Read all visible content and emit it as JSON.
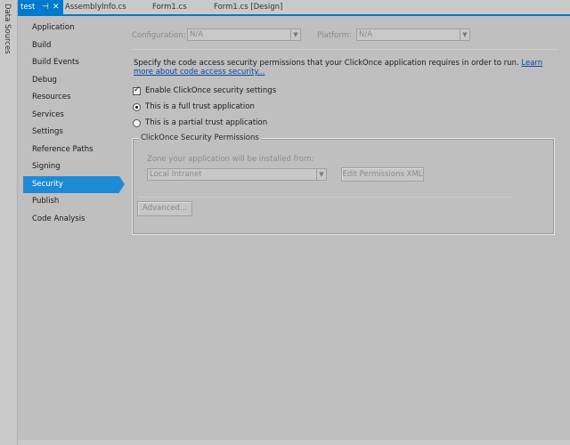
{
  "side_strip": {
    "label": "Data Sources"
  },
  "tabs": {
    "active": {
      "label": "test",
      "pin": "⊣",
      "close": "✕"
    },
    "items": [
      {
        "label": "AssemblyInfo.cs"
      },
      {
        "label": "Form1.cs"
      },
      {
        "label": "Form1.cs [Design]"
      }
    ]
  },
  "nav": {
    "items": [
      {
        "label": "Application"
      },
      {
        "label": "Build"
      },
      {
        "label": "Build Events"
      },
      {
        "label": "Debug"
      },
      {
        "label": "Resources"
      },
      {
        "label": "Services"
      },
      {
        "label": "Settings"
      },
      {
        "label": "Reference Paths"
      },
      {
        "label": "Signing"
      },
      {
        "label": "Security"
      },
      {
        "label": "Publish"
      },
      {
        "label": "Code Analysis"
      }
    ],
    "selected_index": 9
  },
  "config": {
    "configuration_label": "Configuration:",
    "configuration_value": "N/A",
    "platform_label": "Platform:",
    "platform_value": "N/A"
  },
  "security": {
    "description": "Specify the code access security permissions that your ClickOnce application requires in order to run.",
    "learn_more": "Learn more about code access security...",
    "enable_label": "Enable ClickOnce security settings",
    "enable_checked": true,
    "full_trust_label": "This is a full trust application",
    "partial_trust_label": "This is a partial trust application",
    "selected_trust": "full"
  },
  "permissions_group": {
    "title": "ClickOnce Security Permissions",
    "zone_label": "Zone your application will be installed from:",
    "zone_value": "Local Intranet",
    "edit_xml_button": "Edit Permissions XML",
    "advanced_button": "Advanced..."
  },
  "colors": {
    "accent": "#007acc",
    "selection": "#1e8ad6",
    "background": "#bfbfbf"
  }
}
